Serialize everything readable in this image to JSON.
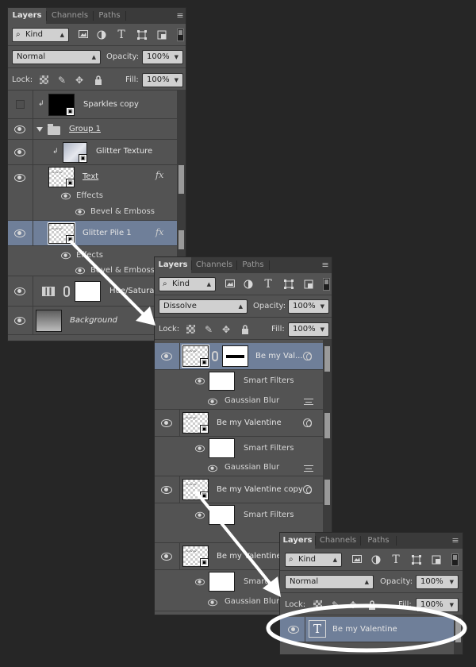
{
  "panel1": {
    "tabs": [
      "Layers",
      "Channels",
      "Paths"
    ],
    "kind": "Kind",
    "blend_mode": "Normal",
    "opacity_label": "Opacity:",
    "opacity": "100%",
    "lock_label": "Lock:",
    "fill_label": "Fill:",
    "fill": "100%",
    "layers": {
      "sparkles": "Sparkles copy",
      "group": "Group 1",
      "glitter_texture": "Glitter Texture",
      "text": "Text",
      "effects": "Effects",
      "bevel": "Bevel & Emboss",
      "glitter_pile": "Glitter Pile 1",
      "effects2": "Effects",
      "bevel2": "Bevel & Emboss",
      "hue": "Hue/Saturat",
      "background": "Background"
    }
  },
  "panel2": {
    "tabs": [
      "Layers",
      "Channels",
      "Paths"
    ],
    "kind": "Kind",
    "blend_mode": "Dissolve",
    "opacity_label": "Opacity:",
    "opacity": "100%",
    "lock_label": "Lock:",
    "fill_label": "Fill:",
    "fill": "100%",
    "layers": {
      "l1": "Be my Val...",
      "sf1": "Smart Filters",
      "gb1": "Gaussian Blur",
      "l2": "Be my Valentine",
      "sf2": "Smart Filters",
      "gb2": "Gaussian Blur",
      "l3": "Be my Valentine copy",
      "sf3": "Smart Filters",
      "l4": "Be my Valentine c",
      "sf4": "Smart",
      "gb4": "Gaussian Blur"
    }
  },
  "panel3": {
    "tabs": [
      "Layers",
      "Channels",
      "Paths"
    ],
    "kind": "Kind",
    "blend_mode": "Normal",
    "opacity_label": "Opacity:",
    "opacity": "100%",
    "lock_label": "Lock:",
    "fill_label": "Fill:",
    "fill": "100%",
    "layer": "Be my Valentine",
    "text_glyph": "T"
  },
  "icons": {
    "fx": "fx",
    "smart_object": "smart-object-icon",
    "eye": "eye-icon",
    "link": "link-icon"
  },
  "colors": {
    "panel_bg": "#535353",
    "selected_row": "#6f7f99",
    "arrow": "#ffffff"
  }
}
